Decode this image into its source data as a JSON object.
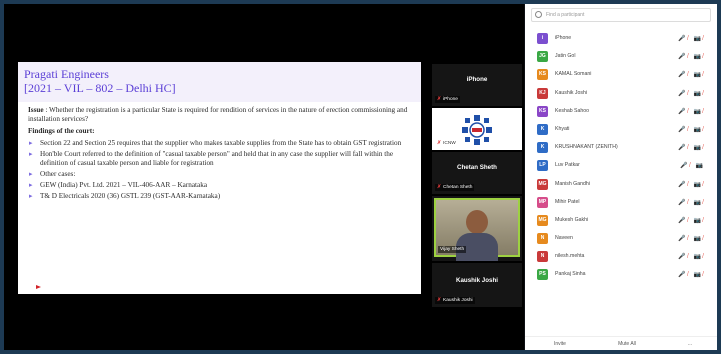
{
  "slide": {
    "title_line1": "Pragati Engineers",
    "title_line2": "[2021 – VIL – 802 – Delhi HC]",
    "issue_label": "Issue",
    "issue_text": " : Whether the registration is a particular State is required for rendition of services in the nature of erection commissioning and installation services?",
    "findings_label": "Findings of the court:",
    "bullets": [
      "Section 22 and Section 25 requires that the supplier who makes taxable supplies from the State has to obtain GST registration",
      "Hon'ble Court referred to the definition of \"casual taxable person\" and held that in any case the supplier will fall within the definition of casual taxable person and liable for registration",
      "Other cases:",
      "GEW (India) Pvt. Ltd. 2021 – VIL-406-AAR – Karnataka",
      "T& D Electricals 2020 (36) GSTL 239 (GST-AAR-Karnataka)"
    ]
  },
  "tiles": [
    {
      "name": "iPhone",
      "tag": "iPhone"
    },
    {
      "name": "",
      "tag": "ICNW"
    },
    {
      "name": "Chetan Sheth",
      "tag": "Chetan Sheth"
    },
    {
      "name": "",
      "tag": "Vijay Sheth"
    },
    {
      "name": "Kaushik Joshi",
      "tag": "Kaushik Joshi"
    }
  ],
  "panel": {
    "search_placeholder": "Find a participant",
    "participants": [
      {
        "initials": "i",
        "name": "iPhone",
        "color": "#7b4fcf",
        "icons": "🎤̸ 📷̸"
      },
      {
        "initials": "JG",
        "name": "Jatin Gol",
        "color": "#3aa845",
        "icons": "🎤̸ 📷̸"
      },
      {
        "initials": "KS",
        "name": "KAMAL Somani",
        "color": "#e68a1e",
        "icons": "🎤̸ 📷̸"
      },
      {
        "initials": "KJ",
        "name": "Kaushik Joshi",
        "color": "#c93a3a",
        "icons": "🎤̸ 📷̸"
      },
      {
        "initials": "KS",
        "name": "Keshab Sahoo",
        "color": "#8a46c7",
        "icons": "🎤̸ 📷̸"
      },
      {
        "initials": "K",
        "name": "Khyati",
        "color": "#2f6cc6",
        "icons": "🎤̸ 📷̸"
      },
      {
        "initials": "K",
        "name": "KRUSHNAKANT (ZENITH)",
        "color": "#2f6cc6",
        "icons": "🎤̸ 📷̸"
      },
      {
        "initials": "LP",
        "name": "Luv Patkar",
        "color": "#2f6cc6",
        "icons": "🎤̸ 📷"
      },
      {
        "initials": "MG",
        "name": "Manish Gandhi",
        "color": "#c93a3a",
        "icons": "🎤̸ 📷̸"
      },
      {
        "initials": "MP",
        "name": "Mihir Patel",
        "color": "#d64d8a",
        "icons": "🎤̸ 📷̸"
      },
      {
        "initials": "MG",
        "name": "Mukesh Gakhi",
        "color": "#e68a1e",
        "icons": "🎤̸ 📷̸"
      },
      {
        "initials": "N",
        "name": "Naveen",
        "color": "#e68a1e",
        "icons": "🎤̸ 📷̸"
      },
      {
        "initials": "N",
        "name": "nilesh.mehta",
        "color": "#c93a3a",
        "icons": "🎤̸ 📷̸"
      },
      {
        "initials": "PS",
        "name": "Pankaj Sinha",
        "color": "#3aa845",
        "icons": "🎤̸ 📷̸"
      }
    ],
    "invite_label": "Invite",
    "mute_all_label": "Mute All",
    "more_label": "..."
  }
}
